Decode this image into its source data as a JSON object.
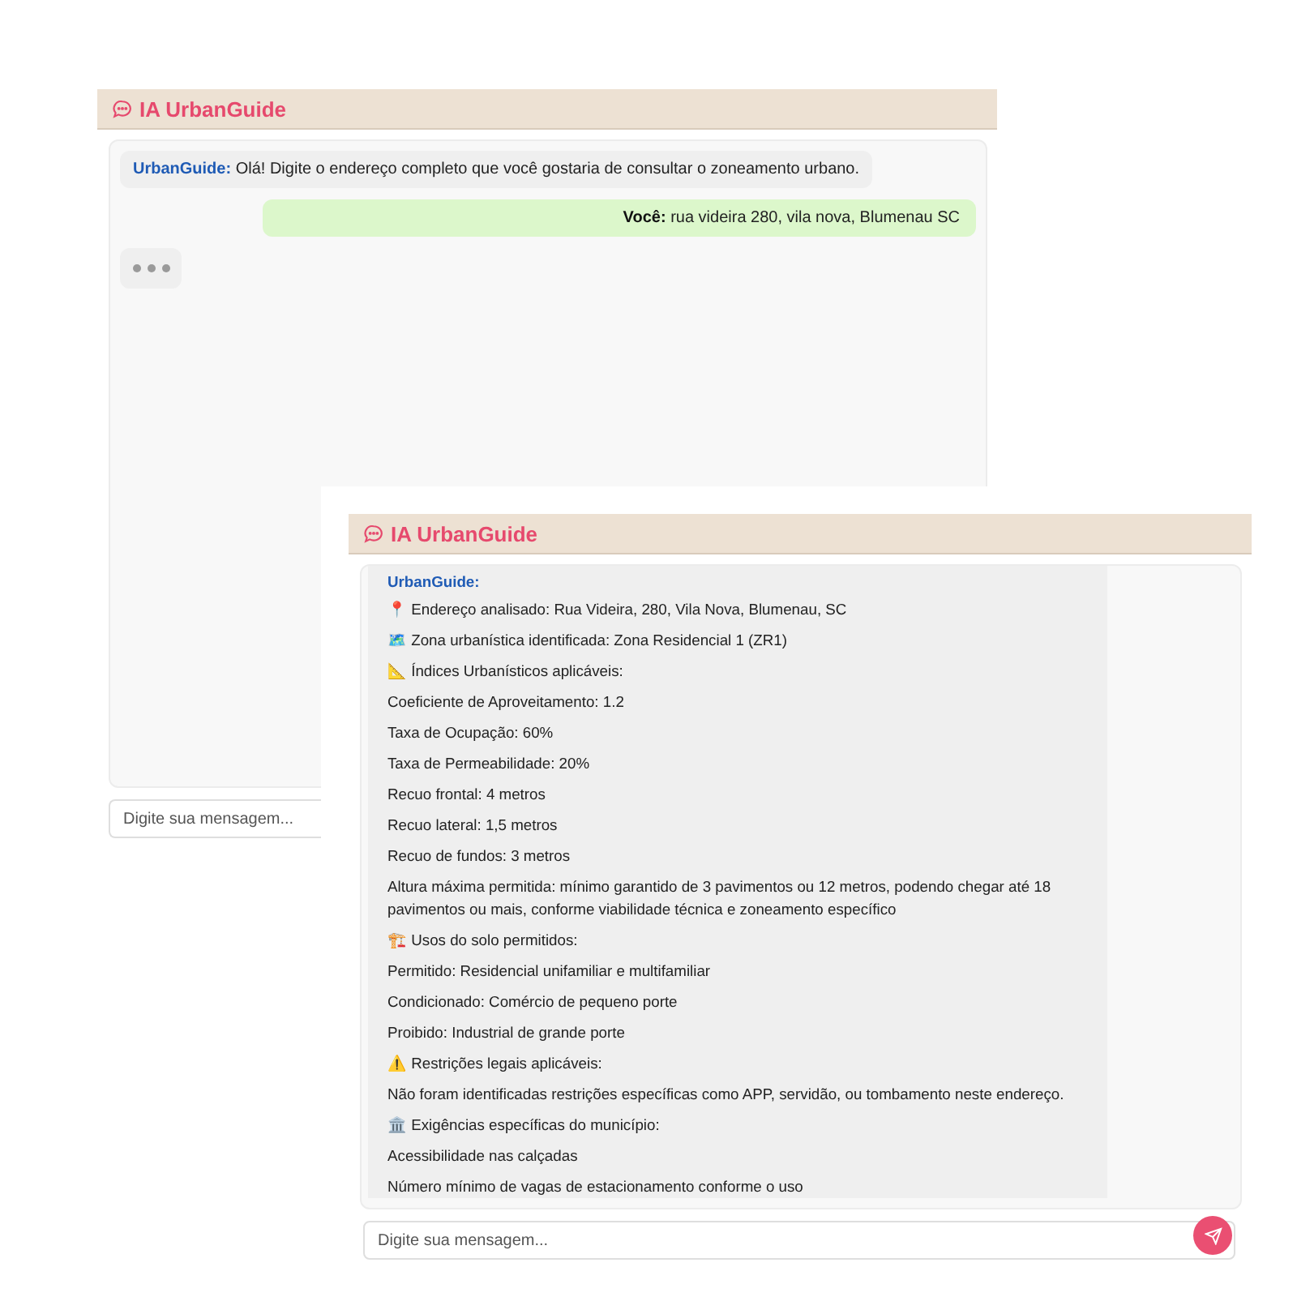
{
  "windows": [
    {
      "title": "IA UrbanGuide",
      "messages": [
        {
          "kind": "bot",
          "sender": "UrbanGuide:",
          "text": "Olá! Digite o endereço completo que você gostaria de consultar o zoneamento urbano."
        },
        {
          "kind": "user",
          "sender": "Você:",
          "text": "rua videira 280, vila nova, Blumenau SC"
        },
        {
          "kind": "typing"
        }
      ],
      "input": {
        "placeholder": "Digite sua mensagem..."
      }
    },
    {
      "title": "IA UrbanGuide",
      "messages": [
        {
          "kind": "report",
          "sender": "UrbanGuide:",
          "lines": [
            "📍 Endereço analisado: Rua Videira, 280, Vila Nova, Blumenau, SC",
            "🗺️ Zona urbanística identificada: Zona Residencial 1 (ZR1)",
            "📐 Índices Urbanísticos aplicáveis:",
            "Coeficiente de Aproveitamento: 1.2",
            "Taxa de Ocupação: 60%",
            "Taxa de Permeabilidade: 20%",
            "Recuo frontal: 4 metros",
            "Recuo lateral: 1,5 metros",
            "Recuo de fundos: 3 metros",
            "Altura máxima permitida: mínimo garantido de 3 pavimentos ou 12 metros, podendo chegar até 18 pavimentos ou mais, conforme viabilidade técnica e zoneamento específico",
            "🏗️ Usos do solo permitidos:",
            "Permitido: Residencial unifamiliar e multifamiliar",
            "Condicionado: Comércio de pequeno porte",
            "Proibido: Industrial de grande porte",
            "⚠️ Restrições legais aplicáveis:",
            "Não foram identificadas restrições específicas como APP, servidão, ou tombamento neste endereço.",
            "🏛️ Exigências específicas do município:",
            "Acessibilidade nas calçadas",
            "Número mínimo de vagas de estacionamento conforme o uso"
          ]
        }
      ],
      "input": {
        "placeholder": "Digite sua mensagem..."
      }
    }
  ]
}
